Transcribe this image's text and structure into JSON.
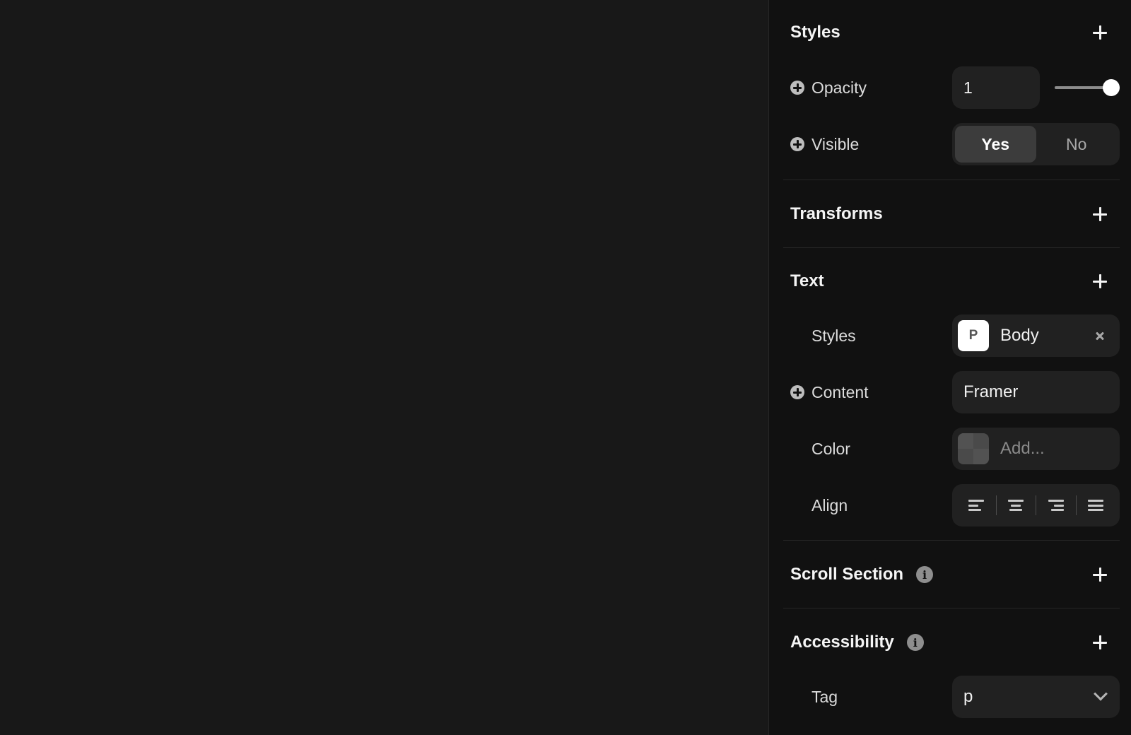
{
  "styles_section": {
    "title": "Styles",
    "opacity": {
      "label": "Opacity",
      "value": "1",
      "slider_fraction": 1.0
    },
    "visible": {
      "label": "Visible",
      "options": [
        "Yes",
        "No"
      ],
      "selected": "Yes"
    }
  },
  "transforms_section": {
    "title": "Transforms"
  },
  "text_section": {
    "title": "Text",
    "styles": {
      "label": "Styles",
      "chip": "P",
      "value": "Body"
    },
    "content": {
      "label": "Content",
      "value": "Framer"
    },
    "color": {
      "label": "Color",
      "placeholder": "Add..."
    },
    "align": {
      "label": "Align",
      "options": [
        "align-left-icon",
        "align-center-icon",
        "align-right-icon",
        "align-justify-icon"
      ]
    }
  },
  "scroll_section": {
    "title": "Scroll Section",
    "info": "i"
  },
  "accessibility_section": {
    "title": "Accessibility",
    "info": "i",
    "tag": {
      "label": "Tag",
      "value": "p"
    }
  },
  "colors": {
    "canvas": "#181818",
    "panel": "#111111",
    "control": "#212121",
    "active_segment": "#3c3c3c"
  }
}
